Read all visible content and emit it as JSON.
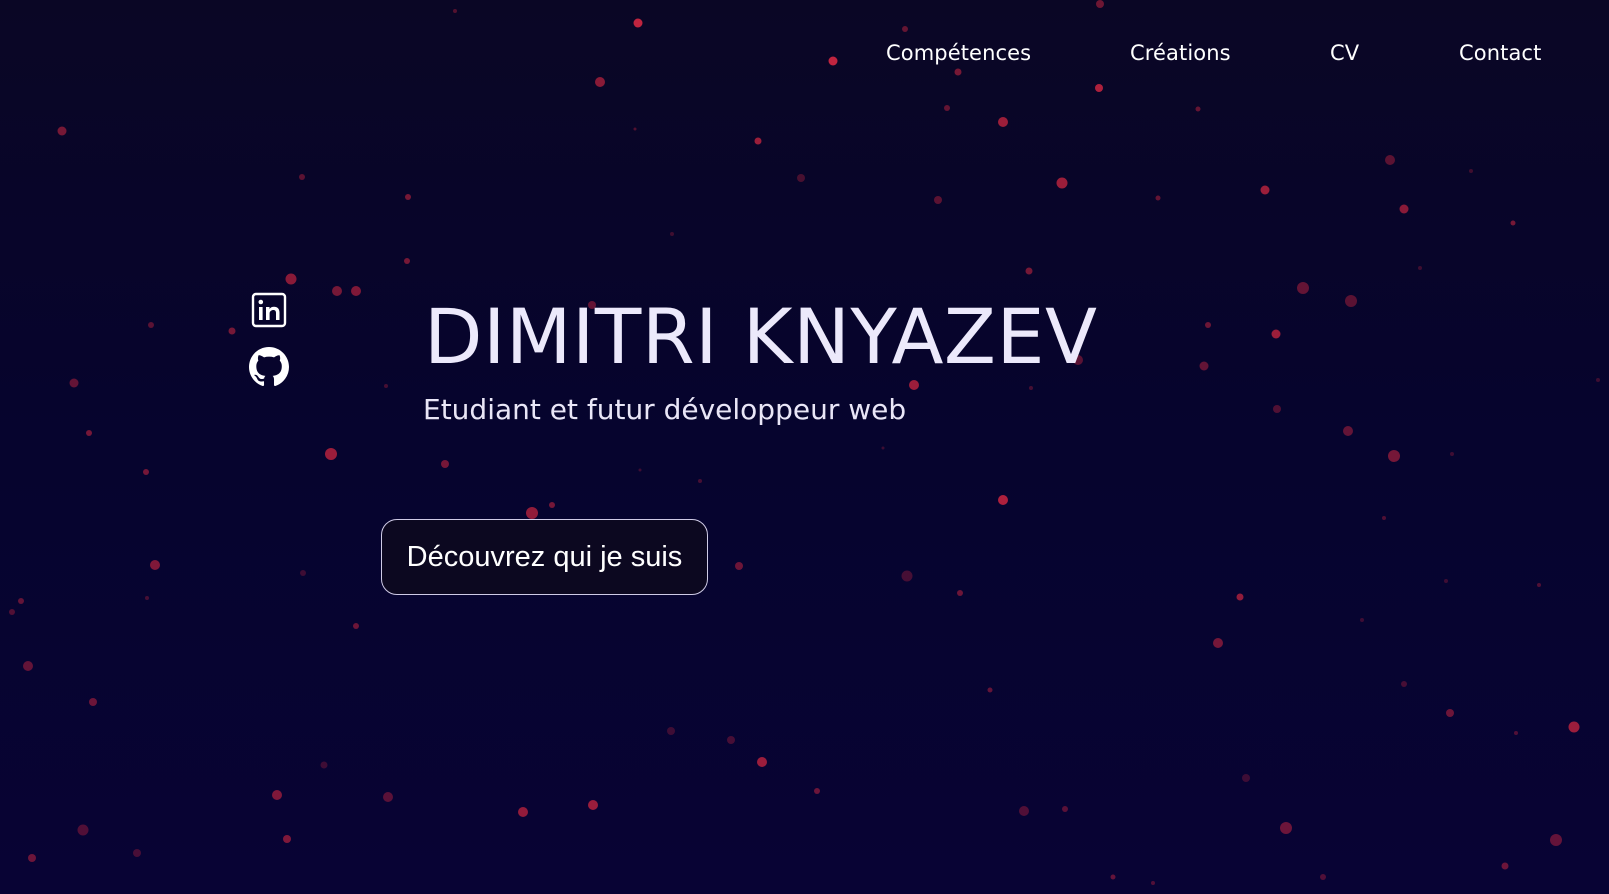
{
  "nav": {
    "items": [
      {
        "label": "Compétences"
      },
      {
        "label": "Créations"
      },
      {
        "label": "CV"
      },
      {
        "label": "Contact"
      }
    ]
  },
  "social": {
    "linkedin_icon": "linkedin-icon",
    "github_icon": "github-icon"
  },
  "hero": {
    "name": "DIMITRI KNYAZEV",
    "tagline": "Etudiant et futur développeur web",
    "cta_label": "Découvrez qui je suis"
  },
  "colors": {
    "background": "#06042e",
    "particle": "#c0243f",
    "text": "#ffffff"
  }
}
